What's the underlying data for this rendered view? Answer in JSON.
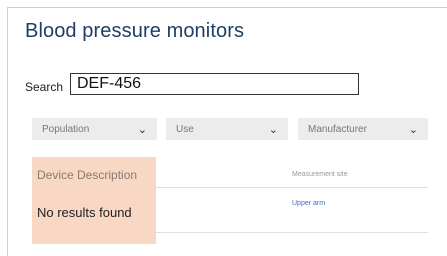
{
  "page": {
    "title": "Blood pressure monitors"
  },
  "search": {
    "label": "Search",
    "value": "DEF-456"
  },
  "filters": [
    {
      "label": "Population",
      "icon": "chevron-down-icon"
    },
    {
      "label": "Use",
      "icon": "chevron-down-icon"
    },
    {
      "label": "Manufacturer",
      "icon": "chevron-down-icon"
    }
  ],
  "table": {
    "columns": [
      "Device Description",
      "Measurement site"
    ],
    "empty_message": "No results found",
    "rows": [
      {
        "measurement_site": "Upper arm"
      }
    ]
  },
  "colors": {
    "title": "#1f3e66",
    "highlight": "#f8d7c4",
    "filter_bg": "#ececec",
    "link": "#3d6fb5"
  }
}
